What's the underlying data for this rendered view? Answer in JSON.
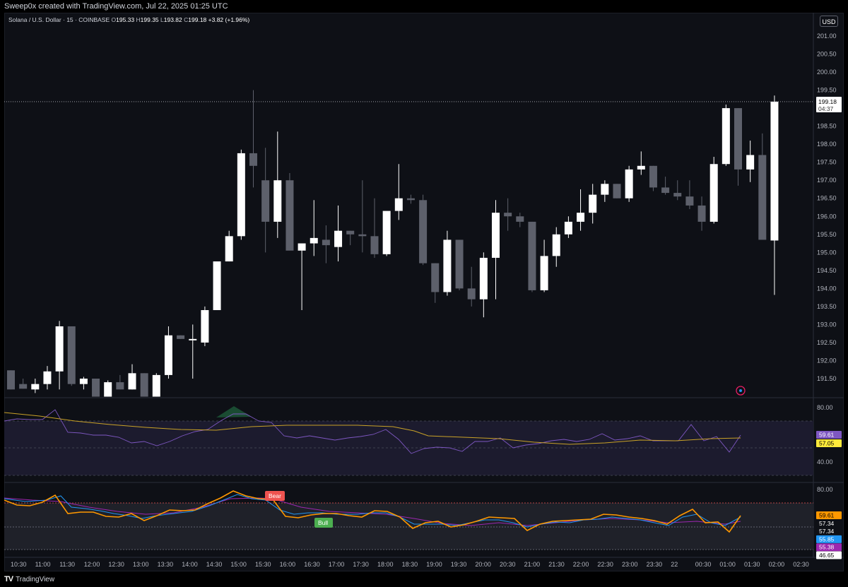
{
  "header": {
    "attribution": "Sweep0x created with TradingView.com, Jul 22, 2025 01:25 UTC"
  },
  "legend": {
    "symbol": "Solana / U.S. Dollar · 15 · COINBASE",
    "open_label": "O",
    "open": "195.33",
    "high_label": "H",
    "high": "199.35",
    "low_label": "L",
    "low": "193.82",
    "close_label": "C",
    "close": "199.18",
    "change": "+3.82 (+1.96%)"
  },
  "currency_button": "USD",
  "price_axis": [
    "201.00",
    "200.50",
    "200.00",
    "199.50",
    "198.50",
    "198.00",
    "197.50",
    "197.00",
    "196.50",
    "196.00",
    "195.50",
    "195.00",
    "194.50",
    "194.00",
    "193.50",
    "193.00",
    "192.50",
    "192.00",
    "191.50"
  ],
  "last_price": {
    "value": "199.18",
    "countdown": "04:37"
  },
  "rsi_axis": {
    "top": "80.00",
    "bottom": "40.00"
  },
  "rsi_badges": [
    {
      "value": "59.61",
      "color": "#7e57c2"
    },
    {
      "value": "57.05",
      "color": "#ffeb3b"
    }
  ],
  "osc_axis": {
    "top": "80.00"
  },
  "osc_badges": [
    {
      "value": "59.61",
      "color": "#ff9800",
      "text": "#000"
    },
    {
      "value": "57.34",
      "color": "#0e1016",
      "text": "#fff"
    },
    {
      "value": "57.34",
      "color": "#0e1016",
      "text": "#fff"
    },
    {
      "value": "55.85",
      "color": "#2196f3",
      "text": "#fff"
    },
    {
      "value": "55.38",
      "color": "#9c27b0",
      "text": "#fff"
    },
    {
      "value": "46.65",
      "color": "#ffffff",
      "text": "#000"
    }
  ],
  "signals": {
    "bear": "Bear",
    "bull": "Bull"
  },
  "time_axis": [
    "10:30",
    "11:00",
    "11:30",
    "12:00",
    "12:30",
    "13:00",
    "13:30",
    "14:00",
    "14:30",
    "15:00",
    "15:30",
    "16:00",
    "16:30",
    "17:00",
    "17:30",
    "18:00",
    "18:30",
    "19:00",
    "19:30",
    "20:00",
    "20:30",
    "21:00",
    "21:30",
    "22:00",
    "22:30",
    "23:00",
    "23:30",
    "22",
    "00:30",
    "01:00",
    "01:30",
    "02:00",
    "02:30"
  ],
  "footer": {
    "brand": "TradingView",
    "logo": "TV"
  },
  "colors": {
    "bull": "#ffffff",
    "bear": "#5d606b",
    "background": "#0e1016"
  },
  "chart_data": {
    "type": "candlestick",
    "ylim": [
      191.2,
      201.3
    ],
    "candles": [
      [
        191.73,
        191.2,
        191.73,
        191.2
      ],
      [
        191.35,
        191.5,
        191.22,
        191.22
      ],
      [
        191.2,
        191.5,
        191.1,
        191.35
      ],
      [
        191.35,
        191.85,
        191.2,
        191.7
      ],
      [
        191.7,
        193.1,
        191.2,
        192.95
      ],
      [
        192.95,
        192.95,
        191.3,
        191.35
      ],
      [
        191.35,
        191.55,
        191.2,
        191.5
      ],
      [
        191.5,
        191.5,
        191.0,
        191.0
      ],
      [
        191.0,
        191.45,
        191.0,
        191.4
      ],
      [
        191.4,
        191.6,
        191.2,
        191.2
      ],
      [
        191.2,
        191.9,
        191.2,
        191.65
      ],
      [
        191.65,
        191.65,
        191.0,
        191.0
      ],
      [
        191.0,
        191.65,
        191.0,
        191.6
      ],
      [
        191.6,
        192.95,
        191.5,
        192.7
      ],
      [
        192.7,
        192.7,
        192.6,
        192.6
      ],
      [
        192.6,
        193.0,
        191.5,
        192.6
      ],
      [
        192.5,
        193.5,
        192.4,
        193.4
      ],
      [
        193.4,
        194.0,
        193.4,
        194.75
      ],
      [
        194.75,
        195.6,
        194.75,
        195.45
      ],
      [
        195.45,
        197.85,
        195.35,
        197.75
      ],
      [
        197.75,
        199.5,
        196.8,
        197.4
      ],
      [
        197.0,
        197.9,
        195.0,
        195.85
      ],
      [
        195.85,
        198.35,
        195.4,
        197.0
      ],
      [
        197.0,
        197.2,
        195.3,
        195.05
      ],
      [
        195.05,
        195.15,
        193.4,
        195.25
      ],
      [
        195.25,
        196.45,
        194.9,
        195.4
      ],
      [
        195.35,
        195.75,
        194.7,
        195.2
      ],
      [
        195.15,
        196.3,
        194.75,
        195.6
      ],
      [
        195.6,
        195.6,
        195.2,
        195.5
      ],
      [
        195.5,
        197.0,
        195.0,
        195.45
      ],
      [
        195.45,
        196.5,
        194.85,
        194.95
      ],
      [
        194.95,
        196.05,
        194.9,
        196.15
      ],
      [
        196.15,
        197.45,
        195.9,
        196.5
      ],
      [
        196.5,
        196.6,
        196.35,
        196.45
      ],
      [
        196.45,
        196.6,
        194.65,
        194.7
      ],
      [
        194.7,
        194.7,
        193.6,
        193.9
      ],
      [
        193.9,
        195.6,
        193.8,
        195.35
      ],
      [
        195.35,
        195.35,
        193.95,
        194.0
      ],
      [
        194.0,
        194.6,
        193.5,
        193.7
      ],
      [
        193.7,
        195.0,
        193.2,
        194.85
      ],
      [
        194.85,
        196.45,
        193.7,
        196.1
      ],
      [
        196.1,
        196.5,
        195.6,
        196.0
      ],
      [
        196.0,
        196.1,
        195.7,
        195.85
      ],
      [
        195.85,
        195.85,
        193.9,
        193.95
      ],
      [
        193.95,
        195.35,
        193.9,
        194.9
      ],
      [
        194.9,
        195.7,
        194.6,
        195.5
      ],
      [
        195.5,
        196.0,
        195.4,
        195.85
      ],
      [
        195.85,
        196.75,
        195.6,
        196.1
      ],
      [
        196.1,
        196.9,
        195.8,
        196.6
      ],
      [
        196.6,
        197.0,
        196.4,
        196.9
      ],
      [
        196.9,
        196.9,
        196.5,
        196.5
      ],
      [
        196.5,
        197.4,
        196.4,
        197.3
      ],
      [
        197.3,
        197.8,
        197.15,
        197.4
      ],
      [
        197.4,
        197.4,
        196.7,
        196.8
      ],
      [
        196.8,
        197.1,
        196.6,
        196.65
      ],
      [
        196.65,
        197.0,
        196.45,
        196.55
      ],
      [
        196.55,
        197.0,
        196.2,
        196.3
      ],
      [
        196.3,
        196.55,
        195.6,
        195.85
      ],
      [
        195.85,
        197.65,
        195.8,
        197.45
      ],
      [
        197.45,
        199.1,
        197.4,
        199.0
      ],
      [
        199.0,
        199.0,
        196.85,
        197.3
      ],
      [
        197.3,
        198.1,
        196.95,
        197.7
      ],
      [
        197.7,
        198.3,
        195.5,
        195.35
      ],
      [
        195.33,
        199.35,
        193.82,
        199.18
      ]
    ]
  }
}
